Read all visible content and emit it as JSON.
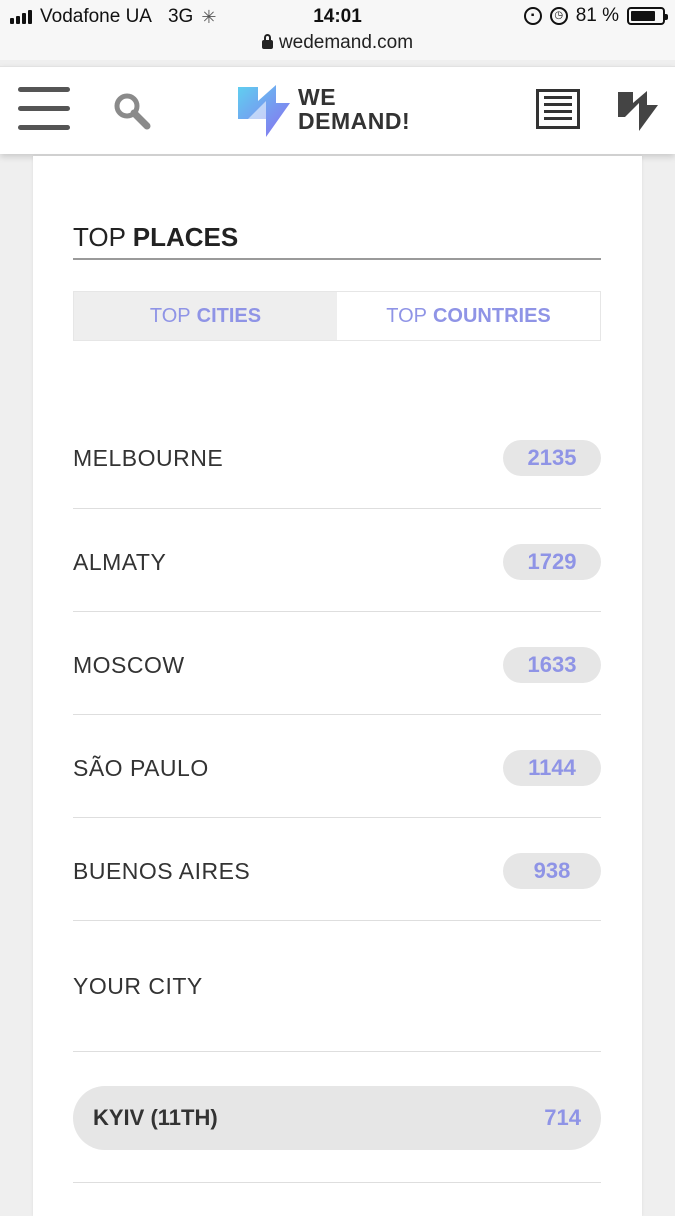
{
  "status_bar": {
    "carrier": "Vodafone UA",
    "network": "3G",
    "time": "14:01",
    "battery_percent": "81 %",
    "battery_level": 0.81
  },
  "browser": {
    "url": "wedemand.com"
  },
  "header": {
    "logo_line1": "WE",
    "logo_line2": "DEMAND!"
  },
  "colors": {
    "accent": "#8f94e6",
    "pill_bg": "#e6e6e6"
  },
  "top_places": {
    "title_light": "TOP",
    "title_bold": "PLACES",
    "tabs": [
      {
        "prefix": "TOP",
        "label": "CITIES",
        "active": true
      },
      {
        "prefix": "TOP",
        "label": "COUNTRIES",
        "active": false
      }
    ],
    "rows": [
      {
        "name": "MELBOURNE",
        "count": "2135"
      },
      {
        "name": "ALMATY",
        "count": "1729"
      },
      {
        "name": "MOSCOW",
        "count": "1633"
      },
      {
        "name": "SÃO PAULO",
        "count": "1144"
      },
      {
        "name": "BUENOS AIRES",
        "count": "938"
      }
    ],
    "your_city_label": "YOUR CITY",
    "your_city": {
      "name": "KYIV (11TH)",
      "count": "714"
    }
  }
}
